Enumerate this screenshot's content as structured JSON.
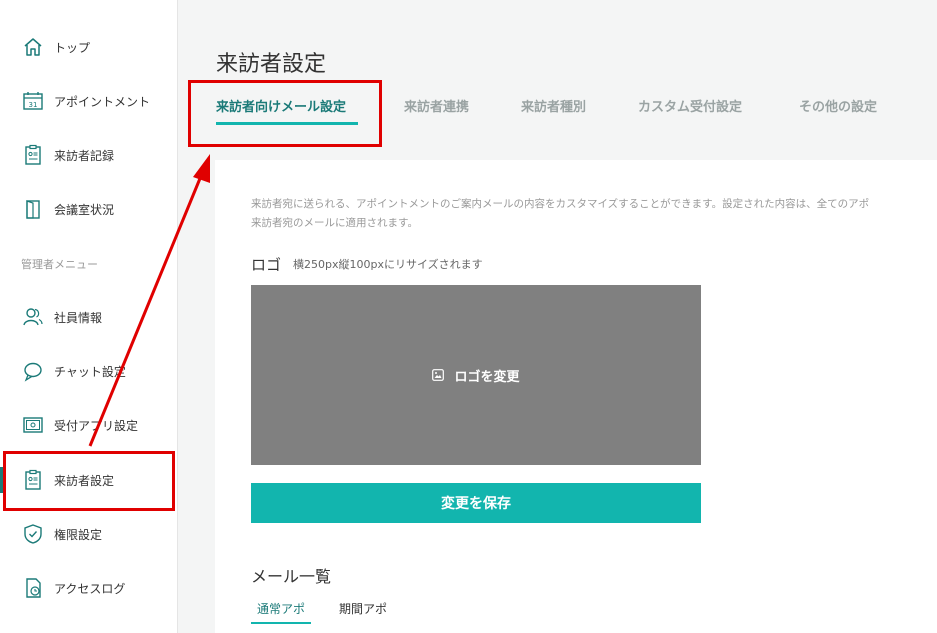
{
  "sidebar": {
    "items": [
      {
        "label": "トップ",
        "icon": "home-icon"
      },
      {
        "label": "アポイントメント",
        "icon": "calendar-icon"
      },
      {
        "label": "来訪者記録",
        "icon": "clipboard-icon"
      },
      {
        "label": "会議室状況",
        "icon": "door-icon"
      },
      {
        "label": "社員情報",
        "icon": "users-icon"
      },
      {
        "label": "チャット設定",
        "icon": "chat-icon"
      },
      {
        "label": "受付アプリ設定",
        "icon": "tablet-icon"
      },
      {
        "label": "来訪者設定",
        "icon": "clipboard-icon"
      },
      {
        "label": "権限設定",
        "icon": "shield-icon"
      },
      {
        "label": "アクセスログ",
        "icon": "log-icon"
      }
    ],
    "section_label": "管理者メニュー"
  },
  "header": {
    "title": "来訪者設定",
    "tabs": [
      {
        "label": "来訪者向けメール設定"
      },
      {
        "label": "来訪者連携"
      },
      {
        "label": "来訪者種別"
      },
      {
        "label": "カスタム受付設定"
      },
      {
        "label": "その他の設定"
      }
    ]
  },
  "main": {
    "description_line1": "来訪者宛に送られる、アポイントメントのご案内メールの内容をカスタマイズすることができます。設定された内容は、全てのアポ",
    "description_line2": "来訪者宛のメールに適用されます。",
    "logo_heading": "ロゴ",
    "logo_note": "横250px縦100pxにリサイズされます",
    "logo_change_label": "ロゴを変更",
    "save_label": "変更を保存",
    "mail_list_heading": "メール一覧",
    "subtabs": [
      {
        "label": "通常アポ"
      },
      {
        "label": "期間アポ"
      }
    ]
  },
  "colors": {
    "accent": "#12b5ae",
    "accent_text": "#1b7a78",
    "annotation": "#e00000",
    "logo_box": "#808080"
  }
}
